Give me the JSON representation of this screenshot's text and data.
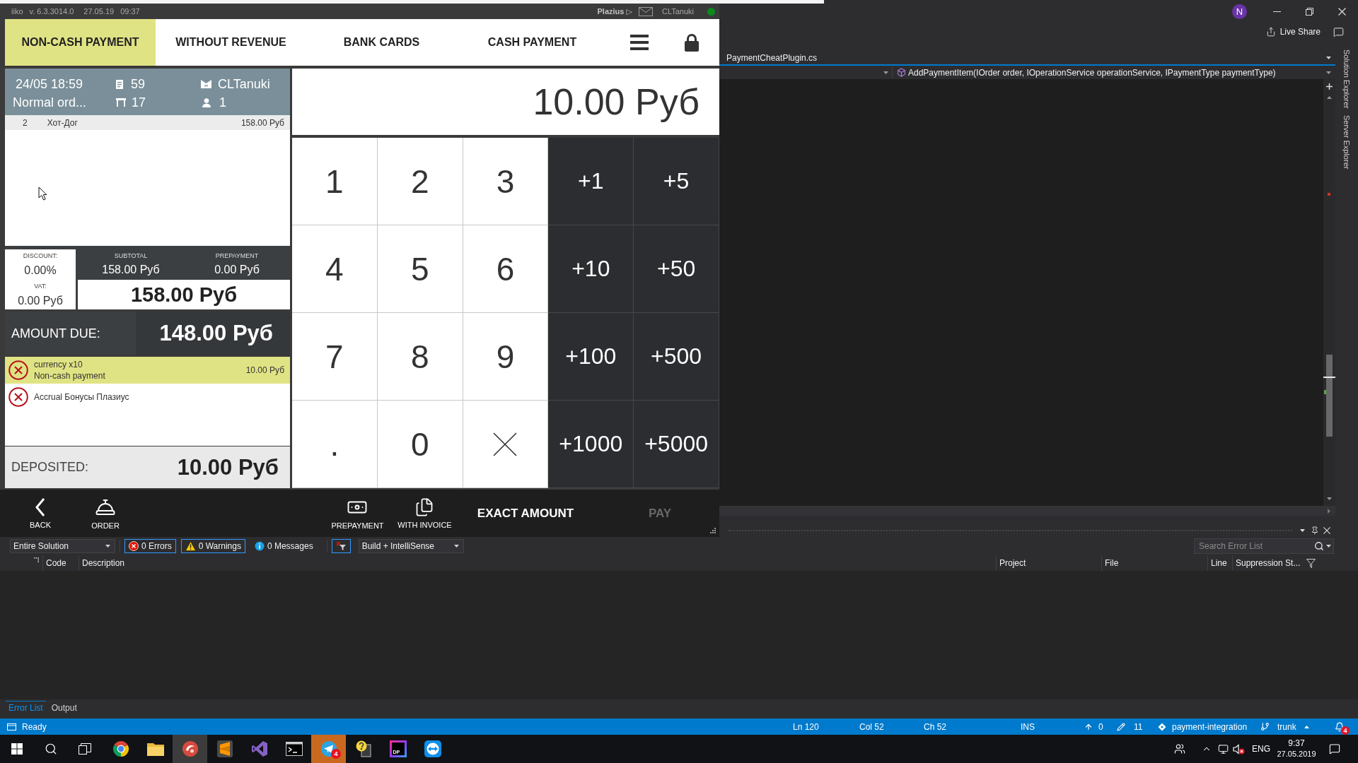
{
  "pos_window": {
    "title_bar": {
      "app_name": "iiko",
      "version": "v. 6.3.3014.0",
      "date": "27.05.19",
      "time": "09:37",
      "plugin": "Plazius ▷",
      "user": "CLTanuki"
    },
    "tabs": [
      {
        "label": "NON-CASH PAYMENT",
        "selected": true
      },
      {
        "label": "WITHOUT REVENUE",
        "selected": false
      },
      {
        "label": "BANK CARDS",
        "selected": false
      },
      {
        "label": "CASH PAYMENT",
        "selected": false
      }
    ],
    "order": {
      "opened": "24/05 18:59",
      "type": "Normal ord...",
      "number": "59",
      "table": "17",
      "waiter": "CLTanuki",
      "guests": "1"
    },
    "items": [
      {
        "quantity": "2",
        "name": "Хот-Дог",
        "price": "158.00 Руб"
      }
    ],
    "totals": {
      "discount_label": "DISCOUNT:",
      "discount": "0.00%",
      "vat_label": "VAT:",
      "vat": "0.00 Руб",
      "subtotal_label": "SUBTOTAL",
      "subtotal": "158.00 Руб",
      "prepayment_label": "PREPAYMENT",
      "prepayment": "0.00 Руб",
      "total": "158.00 Руб"
    },
    "amount_due": {
      "label": "AMOUNT DUE:",
      "value": "148.00 Руб"
    },
    "payments": [
      {
        "title": "currency x10",
        "subtitle": "Non-cash payment",
        "amount": "10.00 Руб",
        "selected": true
      },
      {
        "title": "Accrual Бонусы Плазиус",
        "selected": false
      }
    ],
    "deposited": {
      "label": "DEPOSITED:",
      "value": "10.00 Руб"
    },
    "display": "10.00 Руб",
    "keypad": [
      {
        "kind": "digit",
        "label": "1"
      },
      {
        "kind": "digit",
        "label": "2"
      },
      {
        "kind": "digit",
        "label": "3"
      },
      {
        "kind": "add",
        "label": "+1"
      },
      {
        "kind": "add",
        "label": "+5"
      },
      {
        "kind": "digit",
        "label": "4"
      },
      {
        "kind": "digit",
        "label": "5"
      },
      {
        "kind": "digit",
        "label": "6"
      },
      {
        "kind": "add",
        "label": "+10"
      },
      {
        "kind": "add",
        "label": "+50"
      },
      {
        "kind": "digit",
        "label": "7"
      },
      {
        "kind": "digit",
        "label": "8"
      },
      {
        "kind": "digit",
        "label": "9"
      },
      {
        "kind": "add",
        "label": "+100"
      },
      {
        "kind": "add",
        "label": "+500"
      },
      {
        "kind": "digit",
        "label": "."
      },
      {
        "kind": "digit",
        "label": "0"
      },
      {
        "kind": "clear"
      },
      {
        "kind": "add",
        "label": "+1000"
      },
      {
        "kind": "add",
        "label": "+5000"
      }
    ],
    "toolbar": {
      "left": [
        {
          "kind": "back",
          "label": "BACK",
          "disabled": false
        },
        {
          "kind": "order",
          "label": "ORDER",
          "disabled": false
        }
      ],
      "right": [
        {
          "kind": "prepayment",
          "label": "PREPAYMENT",
          "disabled": false
        },
        {
          "kind": "invoice",
          "label": "WITH INVOICE",
          "disabled": false
        },
        {
          "kind": "plain",
          "label": "EXACT AMOUNT",
          "disabled": false
        },
        {
          "kind": "plain",
          "label": "PAY",
          "disabled": true
        }
      ]
    }
  },
  "ide_window": {
    "account_initial": "N",
    "live_share": "Live Share",
    "document_tab": "PaymentCheatPlugin.cs",
    "member_dropdown": "AddPaymentItem(IOrder order, IOperationService operationService, IPaymentType paymentType)",
    "side_tabs": [
      "Solution Explorer",
      "Server Explorer"
    ],
    "error_list": {
      "scope": "Entire Solution",
      "filters": [
        {
          "kind": "error",
          "label": "0 Errors",
          "selected": true
        },
        {
          "kind": "warning",
          "label": "0 Warnings",
          "selected": true
        },
        {
          "kind": "message",
          "label": "0 Messages",
          "selected": false
        }
      ],
      "document_filter_on": true,
      "build_filter": "Build + IntelliSense",
      "search_placeholder": "Search Error List",
      "columns": [
        "Code",
        "Description",
        "Project",
        "File",
        "Line",
        "Suppression St..."
      ]
    },
    "panel_tabs": [
      {
        "label": "Error List",
        "selected": true
      },
      {
        "label": "Output",
        "selected": false
      }
    ],
    "status_bar": {
      "state": "Ready",
      "line": "Ln 120",
      "column": "Col 52",
      "character": "Ch 52",
      "mode": "INS",
      "unpushed": "0",
      "changes": "11",
      "repository": "payment-integration",
      "branch": "trunk",
      "notifications": "4"
    }
  },
  "taskbar": {
    "apps": [
      {
        "kind": "browser",
        "selected": false,
        "attention": false
      },
      {
        "kind": "folder",
        "selected": false,
        "attention": false
      },
      {
        "kind": "pos-app",
        "selected": true,
        "attention": false
      },
      {
        "kind": "text-editor",
        "selected": false,
        "attention": false
      },
      {
        "kind": "ide",
        "selected": false,
        "attention": false
      },
      {
        "kind": "terminal",
        "selected": false,
        "attention": false
      },
      {
        "kind": "messenger",
        "selected": false,
        "attention": true,
        "badge": "4"
      },
      {
        "kind": "help",
        "selected": false,
        "attention": false
      },
      {
        "kind": "decompiler",
        "selected": false,
        "attention": false,
        "logo_text": "DP"
      },
      {
        "kind": "remote-desktop",
        "selected": false,
        "attention": false
      }
    ],
    "language": "ENG",
    "time": "9:37",
    "date": "27.05.2019"
  }
}
